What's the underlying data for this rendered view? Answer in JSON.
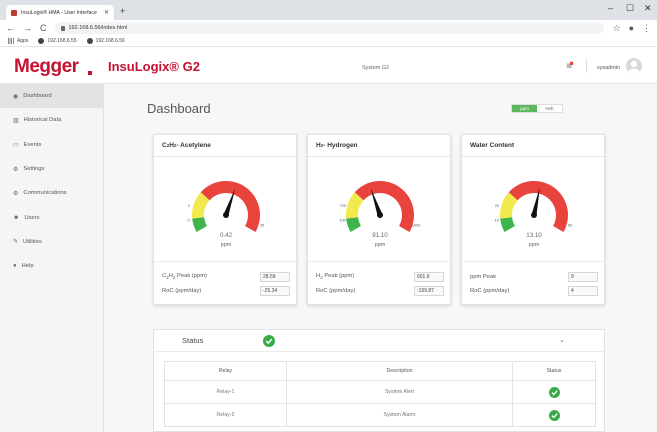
{
  "browser": {
    "tab_title": "InsuLogix® HMA - User Interface",
    "tab_close": "✕",
    "new_tab": "+",
    "url": "192.168.6.56/index.html",
    "win_min": "–",
    "win_max": "☐",
    "win_close": "✕",
    "bookmarks": [
      {
        "label": "Apps",
        "icon": "apps-icon"
      },
      {
        "label": "192.168.6.55",
        "icon": "globe-icon"
      },
      {
        "label": "192.168.6.56",
        "icon": "globe-icon"
      }
    ]
  },
  "header": {
    "logo": "Megger",
    "product": "InsuLogix® G2",
    "system_name": "System G2",
    "username": "sysadmin"
  },
  "sidebar": {
    "items": [
      {
        "label": "Dashboard",
        "icon": "dashboard-icon",
        "active": true
      },
      {
        "label": "Historical Data",
        "icon": "chart-icon"
      },
      {
        "label": "Events",
        "icon": "monitor-icon"
      },
      {
        "label": "Settings",
        "icon": "gear-icon"
      },
      {
        "label": "Communications",
        "icon": "network-icon"
      },
      {
        "label": "Users",
        "icon": "users-icon"
      },
      {
        "label": "Utilities",
        "icon": "wrench-icon"
      },
      {
        "label": "Help",
        "icon": "help-icon"
      }
    ]
  },
  "main": {
    "title": "Dashboard",
    "unit_toggle": [
      "ppm",
      "%rh"
    ],
    "cards": [
      {
        "title_html": [
          "C",
          "2",
          "H",
          "2",
          " - Acetylene"
        ],
        "gauge": {
          "value_fraction": 0.58,
          "ticks": [
            "0",
            "2",
            "35"
          ],
          "zones": [
            "green",
            "yellow",
            "red"
          ]
        },
        "value": "0.42",
        "unit": "ppm",
        "peak_label_parts": [
          "C",
          "2",
          "H",
          "2",
          " Peak (ppm)"
        ],
        "peak_value": "28.59",
        "roc_label": "RoC (ppm/day)",
        "roc_value": "-25.34"
      },
      {
        "title_html": [
          "H",
          "2",
          " - Hydrogen"
        ],
        "gauge": {
          "value_fraction": 0.42,
          "ticks": [
            "100",
            "700",
            "1000"
          ],
          "zones": [
            "green",
            "yellow",
            "red"
          ]
        },
        "value": "91.10",
        "unit": "ppm",
        "peak_label_parts": [
          "H",
          "2",
          " Peak (ppm)"
        ],
        "peak_value": "601.6",
        "roc_label": "RoC (ppm/day)",
        "roc_value": "-159.87"
      },
      {
        "title_html": [
          "Water Content"
        ],
        "gauge": {
          "value_fraction": 0.55,
          "ticks": [
            "10",
            "20",
            "50"
          ],
          "zones": [
            "green",
            "yellow",
            "red"
          ]
        },
        "value": "13.10",
        "unit": "ppm",
        "peak_label_parts": [
          "ppm Peak"
        ],
        "peak_value": "9",
        "roc_label": "RoC (ppm/day)",
        "roc_value": "4"
      }
    ],
    "status": {
      "label": "Status",
      "columns": [
        "Relay",
        "Description",
        "Status"
      ],
      "rows": [
        {
          "relay": "Relay-1",
          "description": "System Alert",
          "status": "ok"
        },
        {
          "relay": "Relay-2",
          "description": "System Alarm",
          "status": "ok"
        }
      ]
    }
  },
  "colors": {
    "brand_red": "#c41230",
    "gauge_green": "#3db54a",
    "gauge_yellow": "#f2e94e",
    "gauge_red": "#e8433c",
    "ok_green": "#3aaa48"
  }
}
